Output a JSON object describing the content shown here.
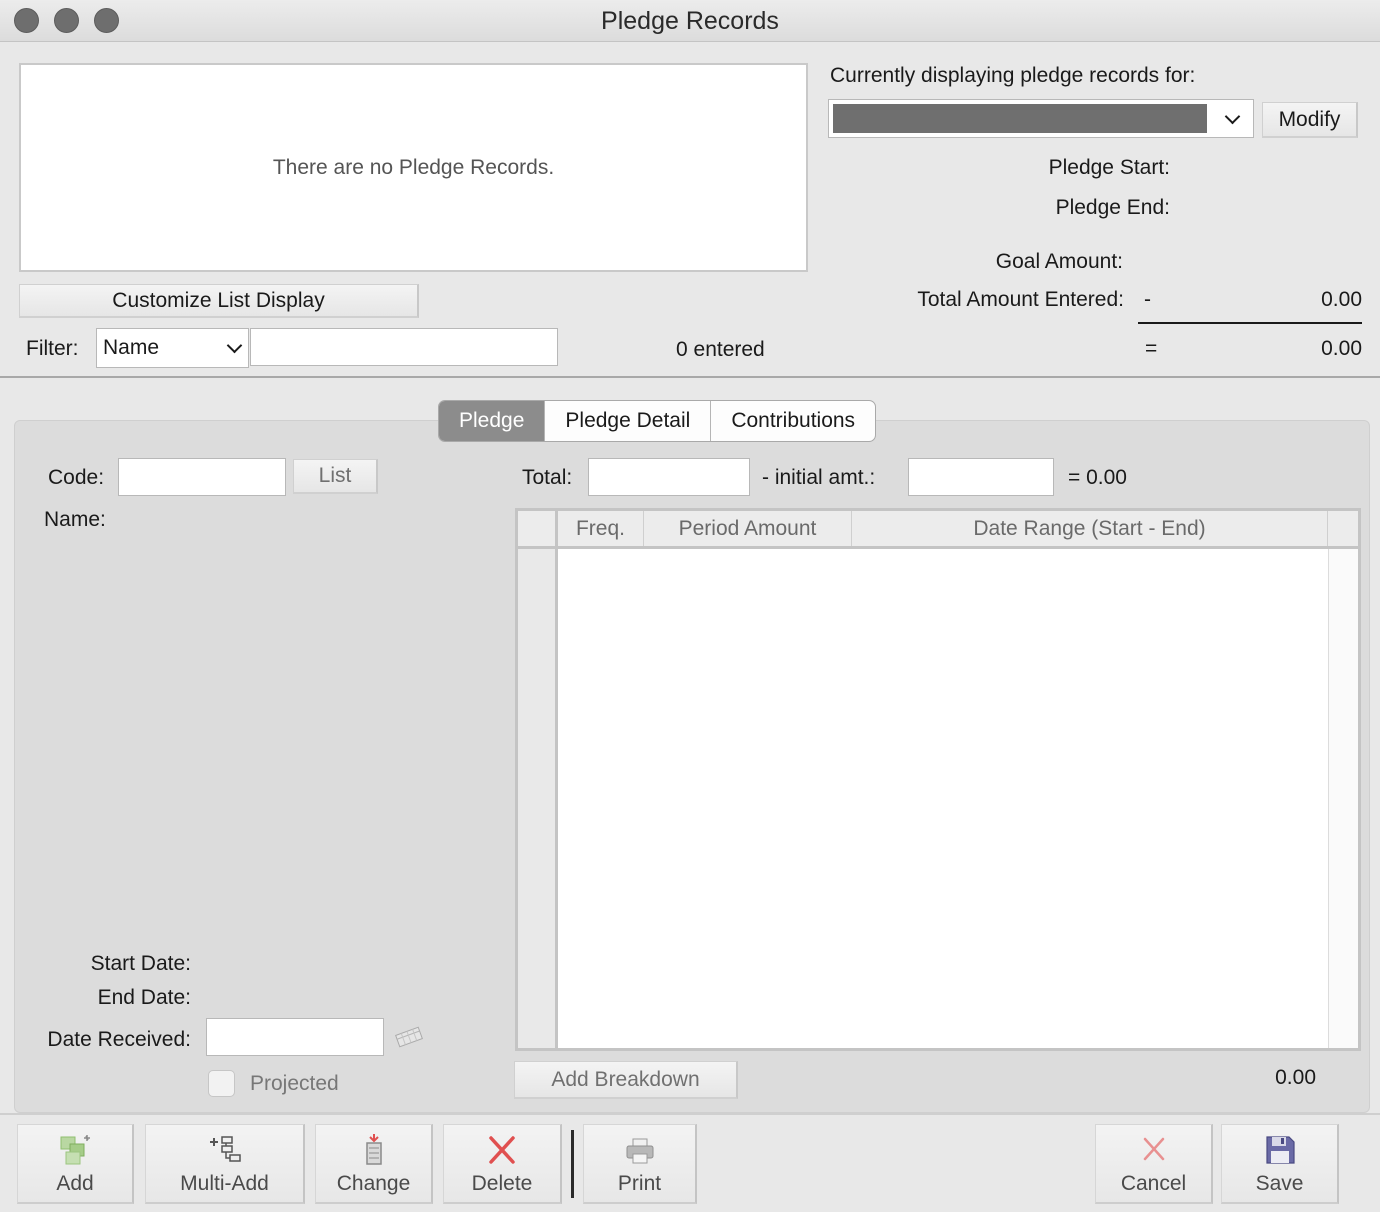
{
  "window": {
    "title": "Pledge Records"
  },
  "records": {
    "empty_message": "There are no Pledge Records."
  },
  "list_controls": {
    "customize_label": "Customize List Display",
    "filter_label": "Filter:",
    "filter_field": "Name",
    "filter_value": "",
    "entered_count": "0 entered"
  },
  "display_for": {
    "label": "Currently displaying pledge records for:",
    "selected": "",
    "modify_label": "Modify",
    "pledge_start_label": "Pledge Start:",
    "pledge_end_label": "Pledge End:",
    "goal_amount_label": "Goal Amount:",
    "total_entered_label": "Total Amount Entered:",
    "minus_sign": "-",
    "total_entered_value": "0.00",
    "equals_sign": "=",
    "difference_value": "0.00"
  },
  "tabs": [
    {
      "label": "Pledge",
      "active": true
    },
    {
      "label": "Pledge Detail",
      "active": false
    },
    {
      "label": "Contributions",
      "active": false
    }
  ],
  "pledge_form": {
    "code_label": "Code:",
    "code_value": "",
    "list_button": "List",
    "name_label": "Name:",
    "start_date_label": "Start Date:",
    "end_date_label": "End Date:",
    "date_received_label": "Date Received:",
    "date_received_value": "",
    "projected_label": "Projected",
    "total_label": "Total:",
    "total_value": "",
    "initial_label": "- initial amt.:",
    "initial_value": "",
    "result_text": "= 0.00"
  },
  "breakdown_grid": {
    "columns": [
      "Freq.",
      "Period Amount",
      "Date Range (Start - End)"
    ],
    "rows": [],
    "add_button": "Add Breakdown",
    "total": "0.00"
  },
  "toolbar": {
    "add": "Add",
    "multi_add": "Multi-Add",
    "change": "Change",
    "delete": "Delete",
    "print": "Print",
    "cancel": "Cancel",
    "save": "Save"
  },
  "colors": {
    "delete_icon": "#e05050",
    "cancel_icon": "#e89090",
    "save_icon": "#5a5a9a",
    "add_icon": "#8fbf6f"
  }
}
